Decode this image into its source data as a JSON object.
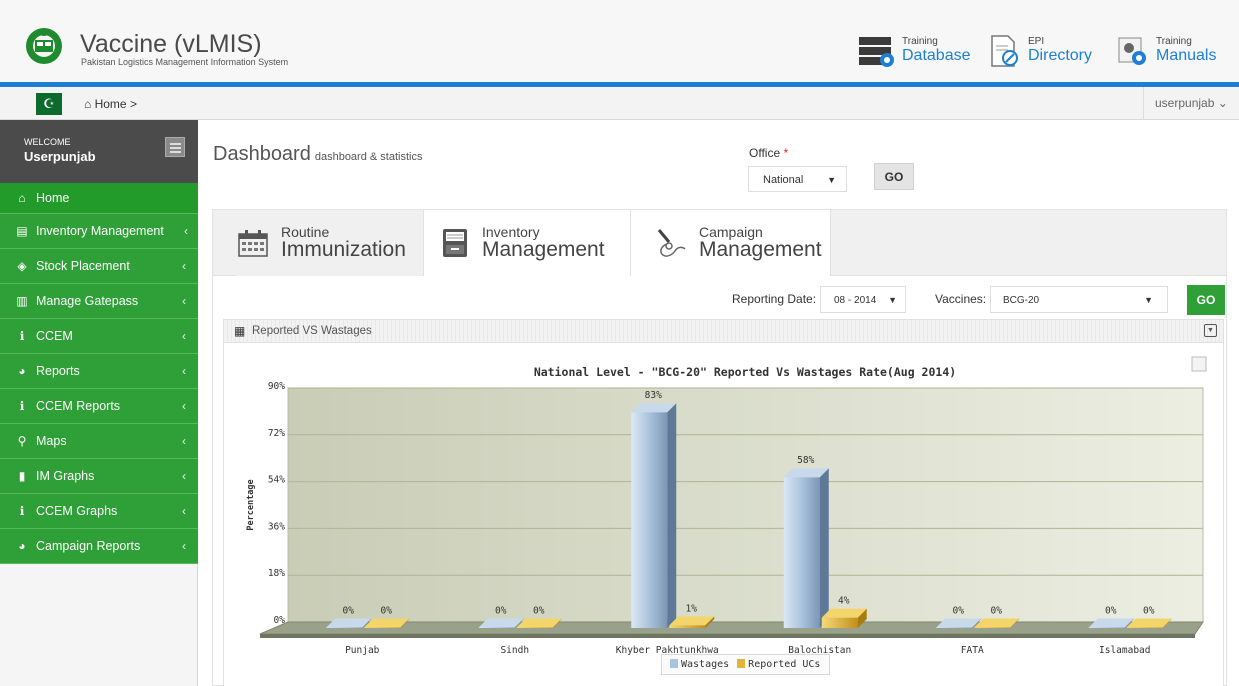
{
  "header": {
    "app_title": "Vaccine (vLMIS)",
    "app_subtitle": "Pakistan Logistics Management Information System",
    "links": [
      {
        "small": "Training",
        "large": "Database",
        "icon": "database-icon"
      },
      {
        "small": "EPI",
        "large": "Directory",
        "icon": "directory-icon"
      },
      {
        "small": "Training",
        "large": "Manuals",
        "icon": "manuals-icon"
      }
    ],
    "accent_color": "#1e7fd4"
  },
  "breadcrumb": {
    "home_label": "Home",
    "separator": ">",
    "user_label": "userpunjab"
  },
  "sidebar": {
    "welcome_label": "WELCOME",
    "username": "Userpunjab",
    "menu_color": "#2fa037",
    "items": [
      {
        "label": "Home",
        "icon": "home-icon"
      },
      {
        "label": "Inventory Management",
        "icon": "inventory-icon"
      },
      {
        "label": "Stock Placement",
        "icon": "placement-icon"
      },
      {
        "label": "Manage Gatepass",
        "icon": "gatepass-icon"
      },
      {
        "label": "CCEM",
        "icon": "info-icon"
      },
      {
        "label": "Reports",
        "icon": "reports-icon"
      },
      {
        "label": "CCEM Reports",
        "icon": "info-icon"
      },
      {
        "label": "Maps",
        "icon": "map-pin-icon"
      },
      {
        "label": "IM Graphs",
        "icon": "bar-graph-icon"
      },
      {
        "label": "CCEM Graphs",
        "icon": "info-icon"
      },
      {
        "label": "Campaign Reports",
        "icon": "reports-icon"
      }
    ]
  },
  "main": {
    "title": "Dashboard",
    "subtitle": "dashboard & statistics",
    "office_label": "Office",
    "office_required": "*",
    "office_value": "National",
    "go_label": "GO",
    "tabs": [
      {
        "small": "Routine",
        "large": "Immunization",
        "icon": "calendar-icon"
      },
      {
        "small": "Inventory",
        "large": "Management",
        "icon": "drawer-icon"
      },
      {
        "small": "Campaign",
        "large": "Management",
        "icon": "dropper-icon"
      }
    ],
    "reporting_date_label": "Reporting Date:",
    "reporting_date_value": "08 - 2014",
    "vaccines_label": "Vaccines:",
    "vaccines_value": "BCG-20",
    "go2_label": "GO",
    "portlet_title": "Reported VS Wastages"
  },
  "chart_data": {
    "type": "bar",
    "title": "National Level - \"BCG-20\" Reported Vs Wastages Rate(Aug 2014)",
    "xlabel": "",
    "ylabel": "Percentage",
    "ylim": [
      0,
      90
    ],
    "yticks": [
      "0%",
      "18%",
      "36%",
      "54%",
      "72%",
      "90%"
    ],
    "categories": [
      "Punjab",
      "Sindh",
      "Khyber Pakhtunkhwa",
      "Balochistan",
      "FATA",
      "Islamabad"
    ],
    "series": [
      {
        "name": "Wastages",
        "values": [
          0,
          0,
          83,
          58,
          0,
          0
        ],
        "labels": [
          "0%",
          "0%",
          "83%",
          "58%",
          "0%",
          "0%"
        ],
        "color": "#a9c4e0"
      },
      {
        "name": "Reported UCs",
        "values": [
          0,
          0,
          1,
          4,
          0,
          0
        ],
        "labels": [
          "0%",
          "0%",
          "1%",
          "4%",
          "0%",
          "0%"
        ],
        "color": "#e1b43a"
      }
    ],
    "grid": true,
    "legend": "bottom"
  }
}
